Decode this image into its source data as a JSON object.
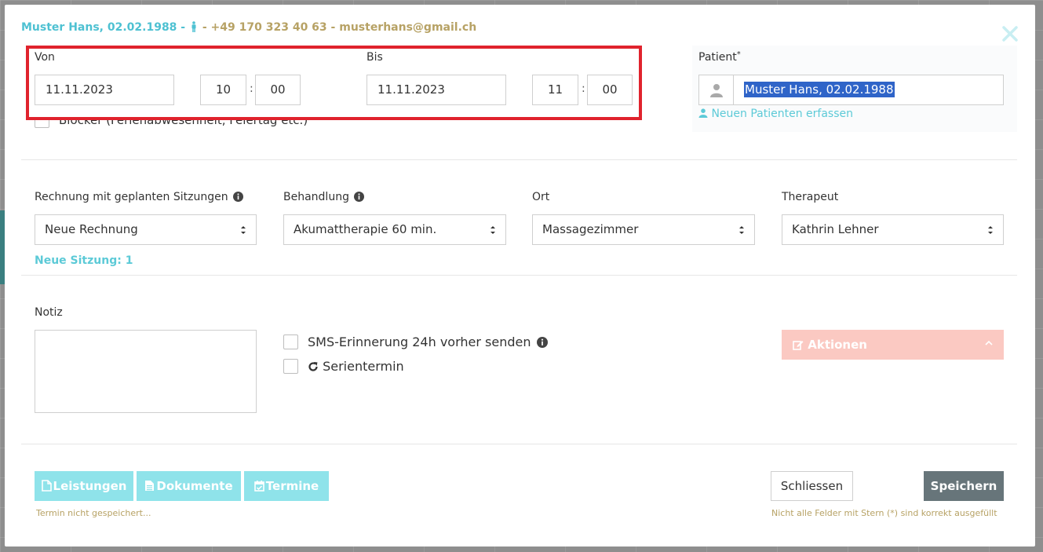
{
  "colors": {
    "teal": "#4ec1d2",
    "gold": "#b7a265",
    "highlight_red": "#e0232d",
    "actions_pink": "#fbc9c2",
    "tab_cyan": "#8fe3ea",
    "save_gray": "#67757a",
    "selection_blue": "#2f64c8"
  },
  "header": {
    "name": "Muster Hans, 02.02.1988",
    "dash1": " - ",
    "dash2": " - ",
    "phone": "+49 170 323 40 63",
    "dash3": " - ",
    "email": "musterhans@gmail.ch",
    "person_icon": "person-icon",
    "close_icon": "close-icon"
  },
  "from": {
    "label": "Von",
    "date": "11.11.2023",
    "hour": "10",
    "minute": "00"
  },
  "to": {
    "label": "Bis",
    "date": "11.11.2023",
    "hour": "11",
    "minute": "00"
  },
  "time_separator": ":",
  "blocker": {
    "label": "Blocker (Ferienabwesenheit, Feiertag etc.)",
    "checked": false
  },
  "patient": {
    "label": "Patient",
    "required_mark": "*",
    "value": "Muster Hans, 02.02.1988",
    "avatar_icon": "user-avatar-icon",
    "new_patient_link": "Neuen Patienten erfassen",
    "new_patient_icon": "user-icon"
  },
  "billing": {
    "invoice_label": "Rechnung mit geplanten Sitzungen",
    "invoice_value": "Neue Rechnung",
    "treatment_label": "Behandlung",
    "treatment_value": "Akumattherapie 60 min.",
    "location_label": "Ort",
    "location_value": "Massagezimmer",
    "therapist_label": "Therapeut",
    "therapist_value": "Kathrin Lehner",
    "new_session_text": "Neue Sitzung: 1"
  },
  "notes": {
    "label": "Notiz",
    "value": ""
  },
  "options": {
    "sms_label": "SMS-Erinnerung 24h vorher senden",
    "sms_checked": false,
    "series_label": "Serientermin",
    "series_checked": false
  },
  "actions": {
    "label": "Aktionen",
    "icon": "edit-icon"
  },
  "footer": {
    "tabs": [
      {
        "label": "Leistungen",
        "icon": "file-icon"
      },
      {
        "label": "Dokumente",
        "icon": "document-icon"
      },
      {
        "label": "Termine",
        "icon": "calendar-check-icon"
      }
    ],
    "status_left": "Termin nicht gespeichert...",
    "status_right": "Nicht alle Felder mit Stern (*) sind korrekt ausgefüllt",
    "close_label": "Schliessen",
    "save_label": "Speichern"
  }
}
